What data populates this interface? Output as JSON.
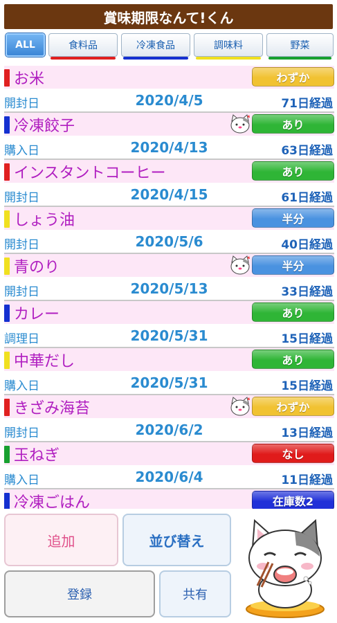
{
  "app": {
    "title": "賞味期限なんて!くん"
  },
  "tabs": [
    {
      "label": "ALL",
      "color": "#3b86d6"
    },
    {
      "label": "食料品",
      "color": "#e02020"
    },
    {
      "label": "冷凍食品",
      "color": "#1530d0"
    },
    {
      "label": "調味料",
      "color": "#f0e020"
    },
    {
      "label": "野菜",
      "color": "#18a030"
    }
  ],
  "items": [
    {
      "name": "お米",
      "category_color": "#e02020",
      "status": "わずか",
      "status_color": "#f1c232",
      "date_type": "開封日",
      "date": "2020/4/5",
      "elapsed": "71日経過",
      "cat_icon": false
    },
    {
      "name": "冷凍餃子",
      "category_color": "#1530d0",
      "status": "あり",
      "status_color": "#2fb536",
      "date_type": "購入日",
      "date": "2020/4/13",
      "elapsed": "63日経過",
      "cat_icon": true
    },
    {
      "name": "インスタントコーヒー",
      "category_color": "#e02020",
      "status": "あり",
      "status_color": "#2fb536",
      "date_type": "開封日",
      "date": "2020/4/15",
      "elapsed": "61日経過",
      "cat_icon": false
    },
    {
      "name": "しょう油",
      "category_color": "#f0e020",
      "status": "半分",
      "status_color": "#4a92e0",
      "date_type": "開封日",
      "date": "2020/5/6",
      "elapsed": "40日経過",
      "cat_icon": false
    },
    {
      "name": "青のり",
      "category_color": "#f0e020",
      "status": "半分",
      "status_color": "#4a92e0",
      "date_type": "開封日",
      "date": "2020/5/13",
      "elapsed": "33日経過",
      "cat_icon": true
    },
    {
      "name": "カレー",
      "category_color": "#1530d0",
      "status": "あり",
      "status_color": "#2fb536",
      "date_type": "調理日",
      "date": "2020/5/31",
      "elapsed": "15日経過",
      "cat_icon": false
    },
    {
      "name": "中華だし",
      "category_color": "#f0e020",
      "status": "あり",
      "status_color": "#2fb536",
      "date_type": "購入日",
      "date": "2020/5/31",
      "elapsed": "15日経過",
      "cat_icon": false
    },
    {
      "name": "きざみ海苔",
      "category_color": "#e02020",
      "status": "わずか",
      "status_color": "#f1c232",
      "date_type": "開封日",
      "date": "2020/6/2",
      "elapsed": "13日経過",
      "cat_icon": true
    },
    {
      "name": "玉ねぎ",
      "category_color": "#18a030",
      "status": "なし",
      "status_color": "#e01b1b",
      "date_type": "購入日",
      "date": "2020/6/4",
      "elapsed": "11日経過",
      "cat_icon": false
    },
    {
      "name": "冷凍ごはん",
      "category_color": "#1530d0",
      "status": "在庫数2",
      "status_color": "#2030d8",
      "date_type": "",
      "date": "",
      "elapsed": "",
      "cat_icon": false
    }
  ],
  "buttons": {
    "add": "追加",
    "sort": "並び替え",
    "register": "登録",
    "share": "共有"
  }
}
